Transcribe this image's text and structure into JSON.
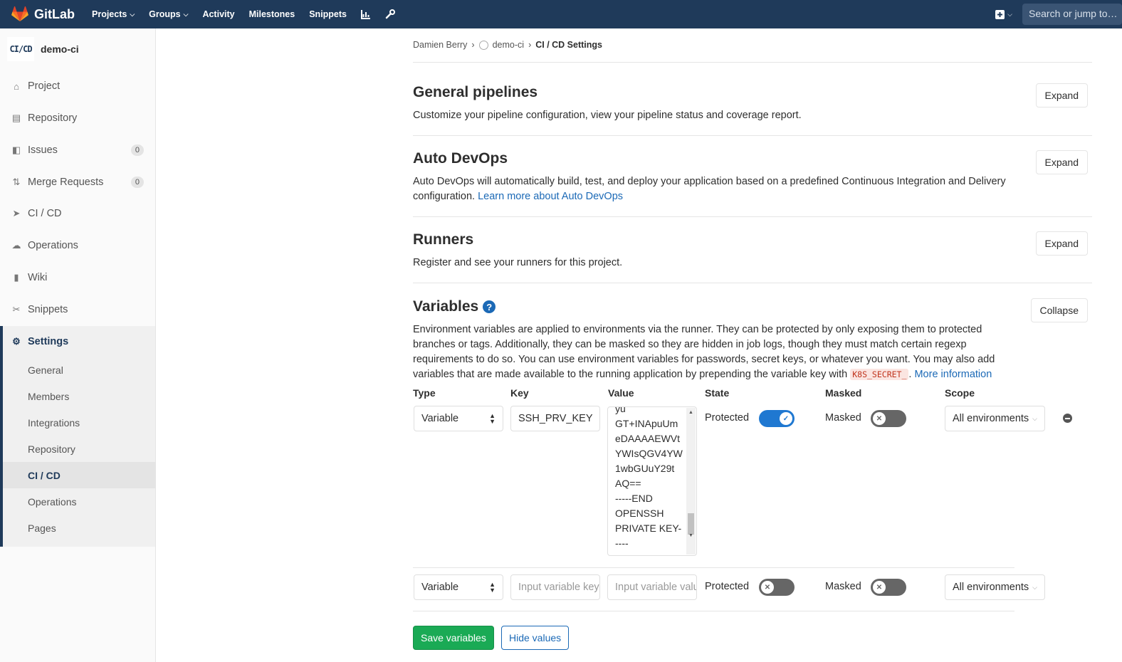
{
  "topbar": {
    "brand": "GitLab",
    "nav": [
      "Projects",
      "Groups",
      "Activity",
      "Milestones",
      "Snippets"
    ],
    "search_placeholder": "Search or jump to…"
  },
  "sidebar": {
    "project_avatar": "CI/CD",
    "project_name": "demo-ci",
    "items": [
      {
        "label": "Project",
        "icon": "home-icon"
      },
      {
        "label": "Repository",
        "icon": "doc-icon"
      },
      {
        "label": "Issues",
        "icon": "issues-icon",
        "count": "0"
      },
      {
        "label": "Merge Requests",
        "icon": "merge-request-icon",
        "count": "0"
      },
      {
        "label": "CI / CD",
        "icon": "rocket-icon"
      },
      {
        "label": "Operations",
        "icon": "cloud-gear-icon"
      },
      {
        "label": "Wiki",
        "icon": "book-icon"
      },
      {
        "label": "Snippets",
        "icon": "scissors-icon"
      },
      {
        "label": "Settings",
        "icon": "gear-icon"
      }
    ],
    "settings_sub": [
      "General",
      "Members",
      "Integrations",
      "Repository",
      "CI / CD",
      "Operations",
      "Pages"
    ]
  },
  "breadcrumb": [
    "Damien Berry",
    "demo-ci",
    "CI / CD Settings"
  ],
  "sections": {
    "general": {
      "title": "General pipelines",
      "desc": "Customize your pipeline configuration, view your pipeline status and coverage report.",
      "button": "Expand"
    },
    "autodevops": {
      "title": "Auto DevOps",
      "desc": "Auto DevOps will automatically build, test, and deploy your application based on a predefined Continuous Integration and Delivery configuration.",
      "link": "Learn more about Auto DevOps",
      "button": "Expand"
    },
    "runners": {
      "title": "Runners",
      "desc": "Register and see your runners for this project.",
      "button": "Expand"
    },
    "variables": {
      "title": "Variables",
      "button": "Collapse",
      "desc": "Environment variables are applied to environments via the runner. They can be protected by only exposing them to protected branches or tags. Additionally, they can be masked so they are hidden in job logs, though they must match certain regexp requirements to do so. You can use environment variables for passwords, secret keys, or whatever you want. You may also add variables that are made available to the running application by prepending the variable key with",
      "code": "K8S_SECRET_",
      "link": "More information",
      "headers": {
        "type": "Type",
        "key": "Key",
        "value": "Value",
        "state": "State",
        "masked": "Masked",
        "scope": "Scope"
      },
      "rows": [
        {
          "type": "Variable",
          "key": "SSH_PRV_KEY",
          "value_lines": [
            "yu",
            "GT+INApuUm",
            "eDAAAAEWVt",
            "YWIsQGV4YW",
            "1wbGUuY29t",
            "AQ==",
            "-----END",
            "OPENSSH",
            "PRIVATE KEY-",
            "----"
          ],
          "state": "Protected",
          "protected": true,
          "masked_label": "Masked",
          "masked": false,
          "scope": "All environments"
        },
        {
          "type": "Variable",
          "key_placeholder": "Input variable key",
          "value_placeholder": "Input variable value",
          "state": "Protected",
          "protected": false,
          "masked_label": "Masked",
          "masked": false,
          "scope": "All environments"
        }
      ],
      "save": "Save variables",
      "hide": "Hide values"
    }
  },
  "colors": {
    "topbar": "#1f3a5a",
    "toggle_on": "#1f78d1",
    "toggle_off": "#666666",
    "save": "#1aaa55",
    "link": "#1b69b6"
  }
}
